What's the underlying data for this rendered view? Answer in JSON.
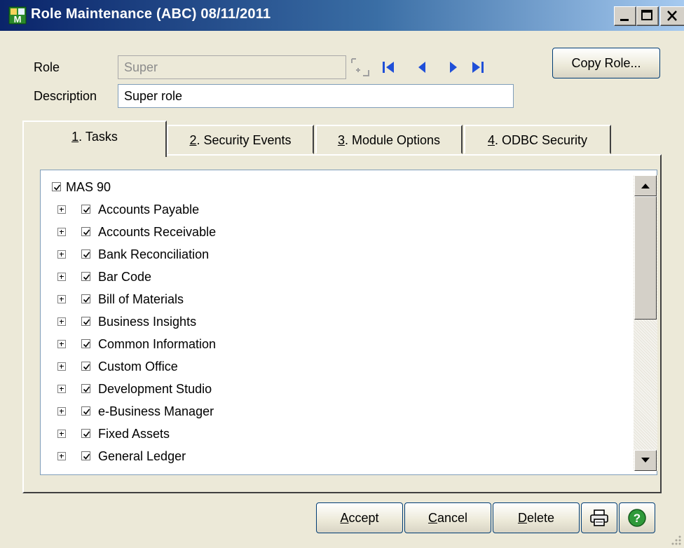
{
  "window": {
    "title": "Role Maintenance (ABC) 08/11/2011"
  },
  "form": {
    "role_label": "Role",
    "role_value": "Super",
    "description_label": "Description",
    "description_value": "Super role",
    "copy_role_button": "Copy Role..."
  },
  "tabs": [
    {
      "num": "1",
      "label": ". Tasks"
    },
    {
      "num": "2",
      "label": ". Security Events"
    },
    {
      "num": "3",
      "label": ". Module Options"
    },
    {
      "num": "4",
      "label": ". ODBC Security"
    }
  ],
  "tree": {
    "root": "MAS 90",
    "items": [
      "Accounts Payable",
      "Accounts Receivable",
      "Bank Reconciliation",
      "Bar Code",
      "Bill of Materials",
      "Business Insights",
      "Common Information",
      "Custom Office",
      "Development Studio",
      "e-Business Manager",
      "Fixed Assets",
      "General Ledger"
    ]
  },
  "buttons": {
    "accept": {
      "hotkey": "A",
      "rest": "ccept"
    },
    "cancel": {
      "hotkey": "C",
      "rest": "ancel"
    },
    "delete": {
      "hotkey": "D",
      "rest": "elete"
    }
  },
  "icons": {
    "app": "mas-app-icon",
    "printer": "printer-icon",
    "help": "help-icon"
  },
  "colors": {
    "title_start": "#0a246a",
    "title_end": "#a6caf0",
    "nav_arrows": "#1f4fd8",
    "help_green": "#2f9a3a"
  }
}
